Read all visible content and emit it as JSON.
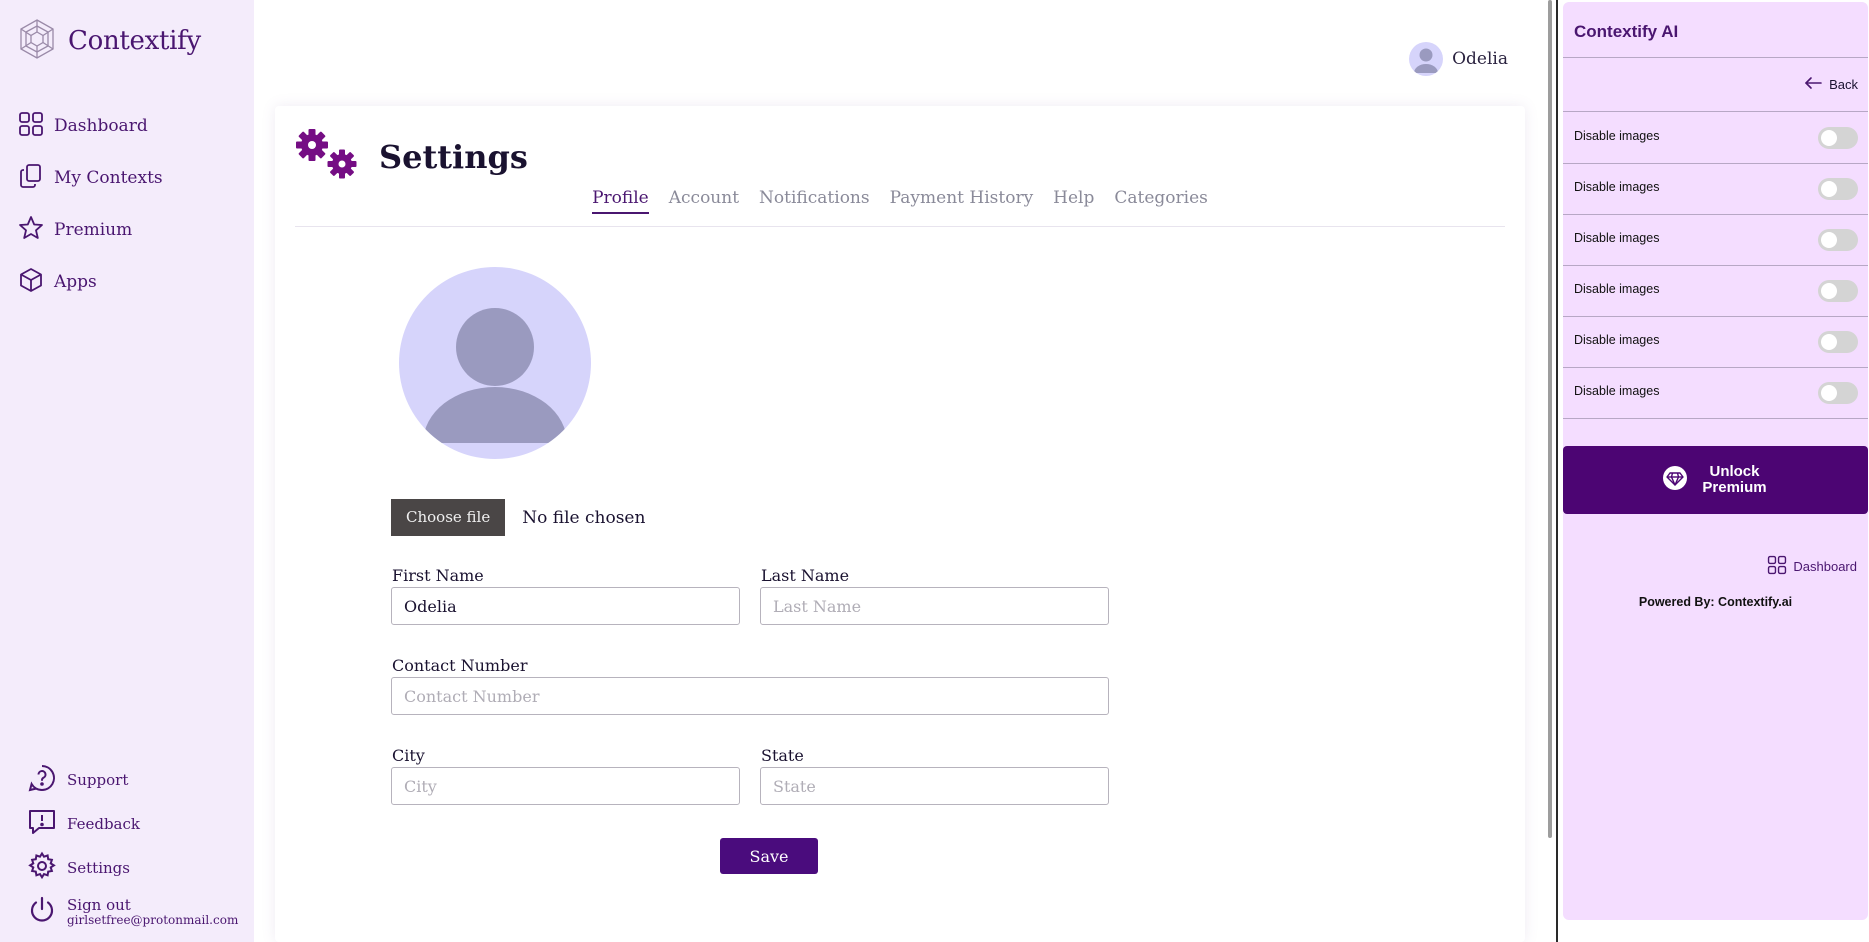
{
  "app": {
    "name": "Contextify"
  },
  "sidebar": {
    "items": [
      {
        "label": "Dashboard",
        "icon": "grid-icon"
      },
      {
        "label": "My Contexts",
        "icon": "copy-icon"
      },
      {
        "label": "Premium",
        "icon": "star-icon"
      },
      {
        "label": "Apps",
        "icon": "cube-icon"
      }
    ],
    "bottom": {
      "support": "Support",
      "feedback": "Feedback",
      "settings": "Settings",
      "signout": "Sign out",
      "email": "girlsetfree@protonmail.com"
    }
  },
  "header": {
    "username": "Odelia"
  },
  "settings": {
    "title": "Settings",
    "tabs": [
      {
        "label": "Profile",
        "active": true
      },
      {
        "label": "Account",
        "active": false
      },
      {
        "label": "Notifications",
        "active": false
      },
      {
        "label": "Payment History",
        "active": false
      },
      {
        "label": "Help",
        "active": false
      },
      {
        "label": "Categories",
        "active": false
      }
    ],
    "file": {
      "button_label": "Choose file",
      "status": "No file chosen"
    },
    "form": {
      "first_name": {
        "label": "First Name",
        "value": "Odelia",
        "placeholder": "First Name"
      },
      "last_name": {
        "label": "Last Name",
        "value": "",
        "placeholder": "Last Name"
      },
      "contact": {
        "label": "Contact Number",
        "value": "",
        "placeholder": "Contact Number"
      },
      "city": {
        "label": "City",
        "value": "",
        "placeholder": "City"
      },
      "state": {
        "label": "State",
        "value": "",
        "placeholder": "State"
      },
      "save_label": "Save"
    }
  },
  "ai_panel": {
    "title": "Contextify AI",
    "back_label": "Back",
    "toggles": [
      {
        "label": "Disable images",
        "on": false
      },
      {
        "label": "Disable images",
        "on": false
      },
      {
        "label": "Disable images",
        "on": false
      },
      {
        "label": "Disable images",
        "on": false
      },
      {
        "label": "Disable images",
        "on": false
      },
      {
        "label": "Disable images",
        "on": false
      }
    ],
    "unlock_label": "Unlock Premium",
    "dashboard_label": "Dashboard",
    "powered_by": "Powered By: Contextify.ai"
  },
  "colors": {
    "brand": "#4a1670",
    "accent": "#4a0c7d",
    "sidebar_bg": "#f4ecfb",
    "panel_bg": "#f4ddff",
    "avatar_bg": "#d6d4fb"
  }
}
